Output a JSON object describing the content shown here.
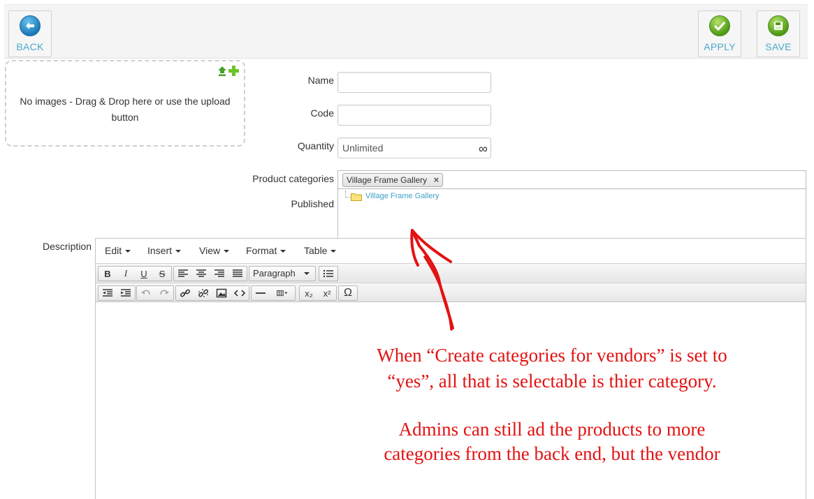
{
  "toolbar": {
    "back_label": "BACK",
    "apply_label": "APPLY",
    "save_label": "SAVE"
  },
  "images": {
    "empty_message": "No images - Drag & Drop here or use the upload button"
  },
  "form": {
    "name_label": "Name",
    "name_value": "",
    "code_label": "Code",
    "code_value": "",
    "quantity_label": "Quantity",
    "quantity_value": "Unlimited",
    "quantity_unlimited_symbol": "∞",
    "categories_label": "Product categories",
    "selected_category": "Village Frame Gallery",
    "chip_remove": "×",
    "category_options": [
      "Village Frame Gallery"
    ],
    "published_label": "Published",
    "description_label": "Description"
  },
  "editor": {
    "menus": [
      "Edit",
      "Insert",
      "View",
      "Format",
      "Table"
    ],
    "block_format": "Paragraph",
    "bold": "B",
    "italic": "I",
    "underline": "U",
    "strike": "S",
    "omega": "Ω",
    "subscript": "x₂",
    "superscript": "x²"
  },
  "annotation": {
    "color": "#e31212",
    "line1": "When “Create categories for vendors” is set to",
    "line2": "“yes”, all that is selectable is thier category.",
    "line3": "Admins can still ad the products to more",
    "line4": "categories from the back end, but the vendor"
  }
}
